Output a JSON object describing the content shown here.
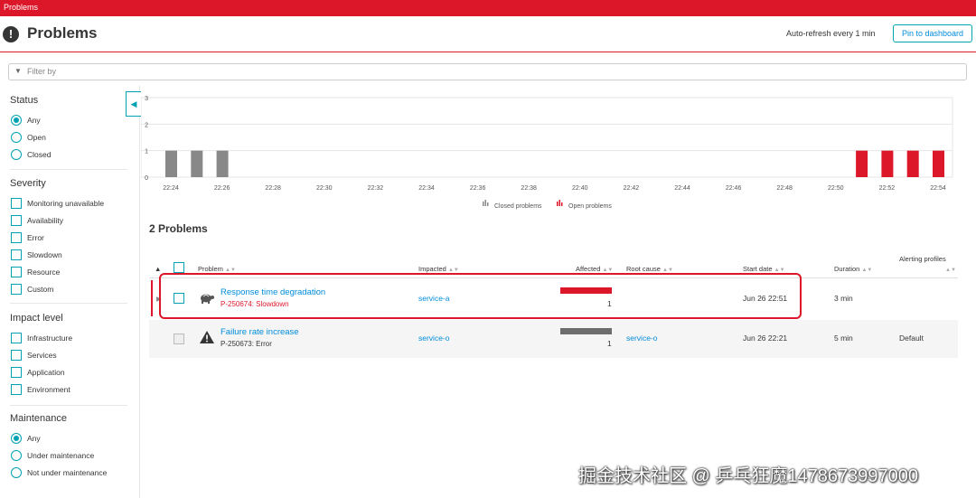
{
  "topbar": {
    "title": "Problems"
  },
  "header": {
    "title": "Problems",
    "auto_refresh": "Auto-refresh every 1 min",
    "pin_label": "Pin to dashboard"
  },
  "filter": {
    "placeholder": "Filter by"
  },
  "sidebar": {
    "status": {
      "title": "Status",
      "options": [
        "Any",
        "Open",
        "Closed"
      ],
      "selected": "Any"
    },
    "severity": {
      "title": "Severity",
      "options": [
        "Monitoring unavailable",
        "Availability",
        "Error",
        "Slowdown",
        "Resource",
        "Custom"
      ]
    },
    "impact": {
      "title": "Impact level",
      "options": [
        "Infrastructure",
        "Services",
        "Application",
        "Environment"
      ]
    },
    "maintenance": {
      "title": "Maintenance",
      "options": [
        "Any",
        "Under maintenance",
        "Not under maintenance"
      ],
      "selected": "Any"
    }
  },
  "chart_data": {
    "type": "bar",
    "x_ticks": [
      "22:24",
      "22:26",
      "22:28",
      "22:30",
      "22:32",
      "22:34",
      "22:36",
      "22:38",
      "22:40",
      "22:42",
      "22:44",
      "22:46",
      "22:48",
      "22:50",
      "22:52",
      "22:54"
    ],
    "y_ticks": [
      0,
      1,
      2,
      3
    ],
    "ylim": [
      0,
      3
    ],
    "grid": true,
    "legend_position": "bottom-center",
    "series": [
      {
        "name": "Closed problems",
        "color": "#888888",
        "points": [
          [
            "22:24",
            1
          ],
          [
            "22:25",
            1
          ],
          [
            "22:26",
            1
          ]
        ]
      },
      {
        "name": "Open problems",
        "color": "#dc172a",
        "points": [
          [
            "22:51",
            1
          ],
          [
            "22:52",
            1
          ],
          [
            "22:53",
            1
          ],
          [
            "22:54",
            1
          ]
        ]
      }
    ]
  },
  "table": {
    "count_title": "2 Problems",
    "columns": {
      "problem": "Problem",
      "impacted": "Impacted",
      "affected": "Affected",
      "root_cause": "Root cause",
      "start_date": "Start date",
      "duration": "Duration",
      "alerting": "Alerting profiles"
    },
    "rows": [
      {
        "title": "Response time degradation",
        "subtitle": "P-250674: Slowdown",
        "impacted": "service-a",
        "affected_count": "1",
        "root_cause": "",
        "start_date": "Jun 26 22:51",
        "duration": "3 min",
        "alerting": "",
        "icon": "turtle-icon",
        "bar_color": "#dc172a"
      },
      {
        "title": "Failure rate increase",
        "subtitle": "P-250673: Error",
        "impacted": "service-o",
        "affected_count": "1",
        "root_cause": "service-o",
        "start_date": "Jun 26 22:21",
        "duration": "5 min",
        "alerting": "Default",
        "icon": "warning-icon",
        "bar_color": "#6d6d6d"
      }
    ]
  },
  "watermark": "掘金技术社区 @ 乒乓狂魔1478673997000"
}
